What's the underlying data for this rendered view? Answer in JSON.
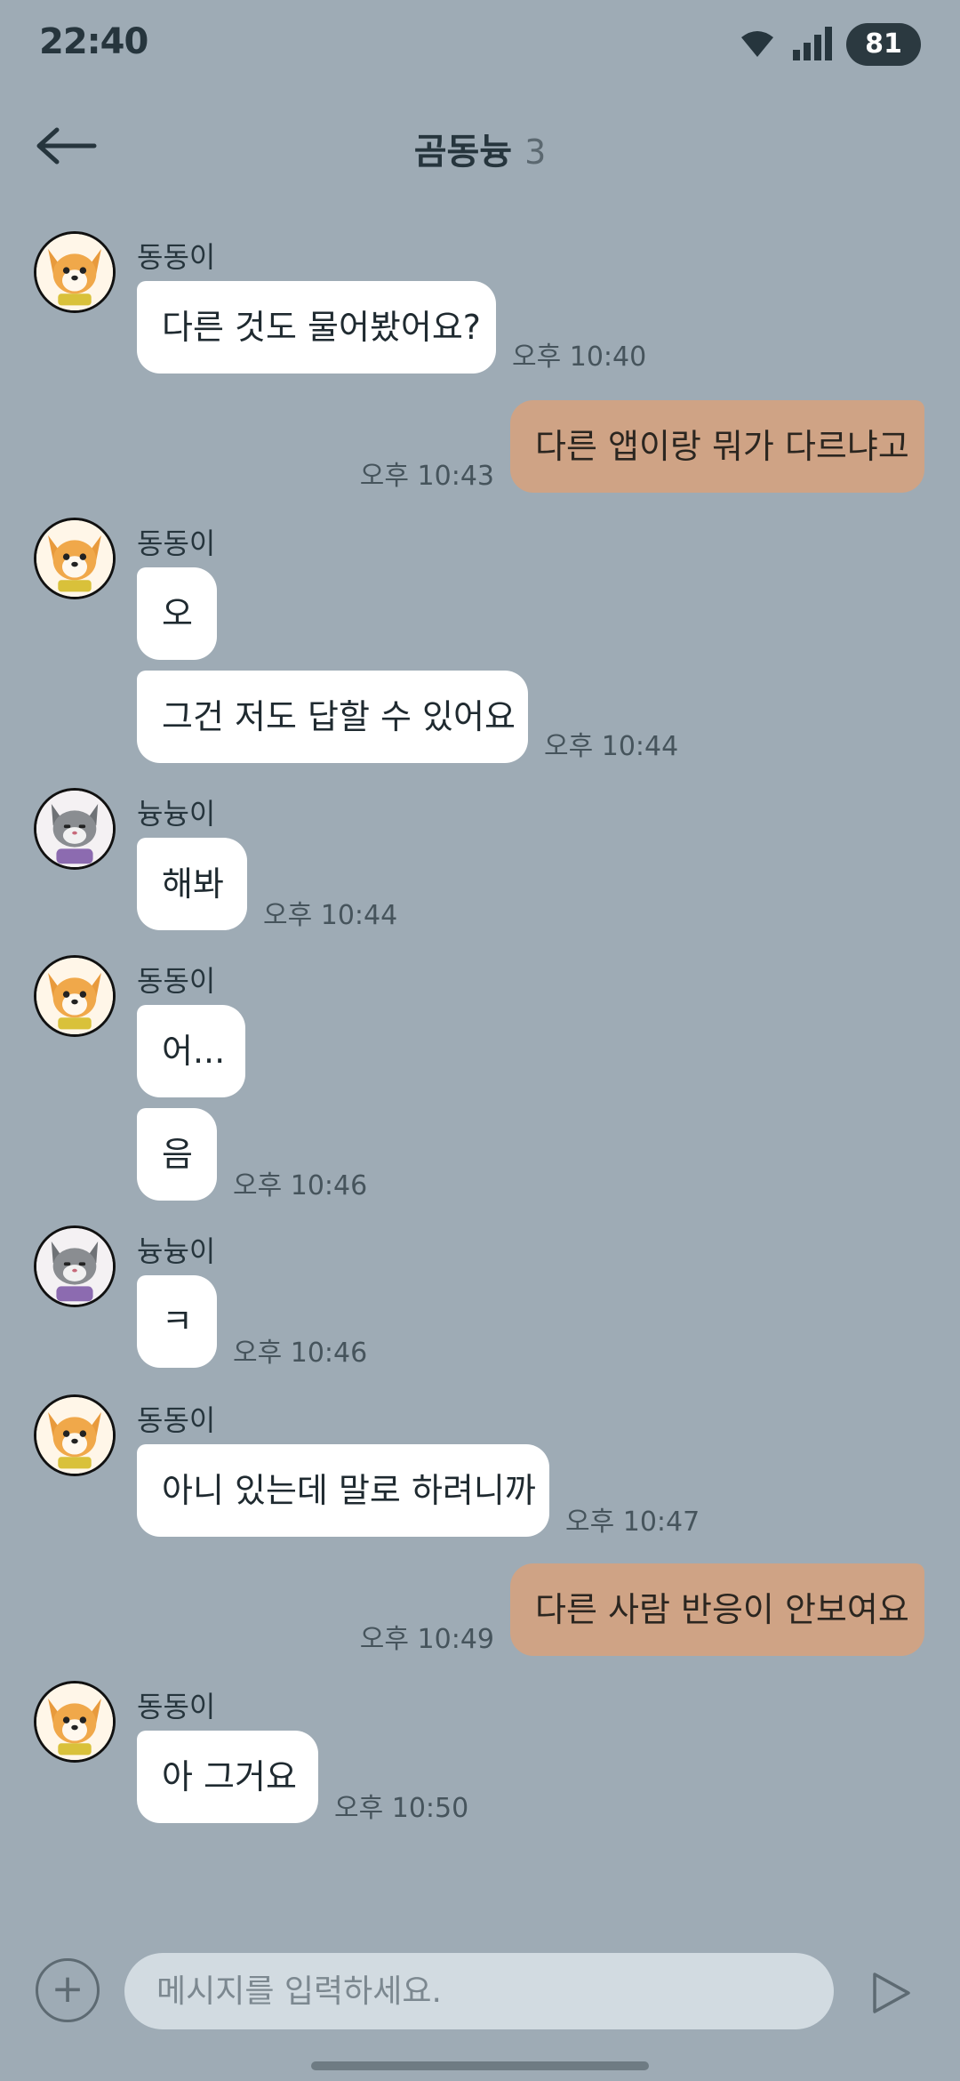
{
  "status_bar": {
    "time": "22:40",
    "battery": "81"
  },
  "header": {
    "title": "곰동늉",
    "member_count": "3"
  },
  "composer": {
    "placeholder": "메시지를 입력하세요.",
    "plus_label": "+"
  },
  "messages": [
    {
      "sender": "동동이",
      "avatar": "dog-avatar-icon",
      "text": "다른 것도 물어봤어요?",
      "time": "오후 10:40"
    },
    {
      "outgoing": true,
      "text": "다른 앱이랑 뭐가 다르냐고",
      "time": "오후 10:43"
    },
    {
      "sender": "동동이",
      "avatar": "dog-avatar-icon",
      "text": "오"
    },
    {
      "text": "그건 저도 답할 수 있어요",
      "time": "오후 10:44"
    },
    {
      "sender": "늉늉이",
      "avatar": "cat-avatar-icon",
      "text": "해봐",
      "time": "오후 10:44"
    },
    {
      "sender": "동동이",
      "avatar": "dog-avatar-icon",
      "text": "어..."
    },
    {
      "text": "음",
      "time": "오후 10:46"
    },
    {
      "sender": "늉늉이",
      "avatar": "cat-avatar-icon",
      "text": "ㅋ",
      "time": "오후 10:46"
    },
    {
      "sender": "동동이",
      "avatar": "dog-avatar-icon",
      "text": "아니 있는데 말로 하려니까",
      "time": "오후 10:47"
    },
    {
      "outgoing": true,
      "text": "다른 사람 반응이 안보여요",
      "time": "오후 10:49"
    },
    {
      "sender": "동동이",
      "avatar": "dog-avatar-icon",
      "text": "아 그거요",
      "time": "오후 10:50"
    }
  ],
  "colors": {
    "background": "#9eabb5",
    "incoming_bubble": "#ffffff",
    "outgoing_bubble": "#cfa385"
  }
}
